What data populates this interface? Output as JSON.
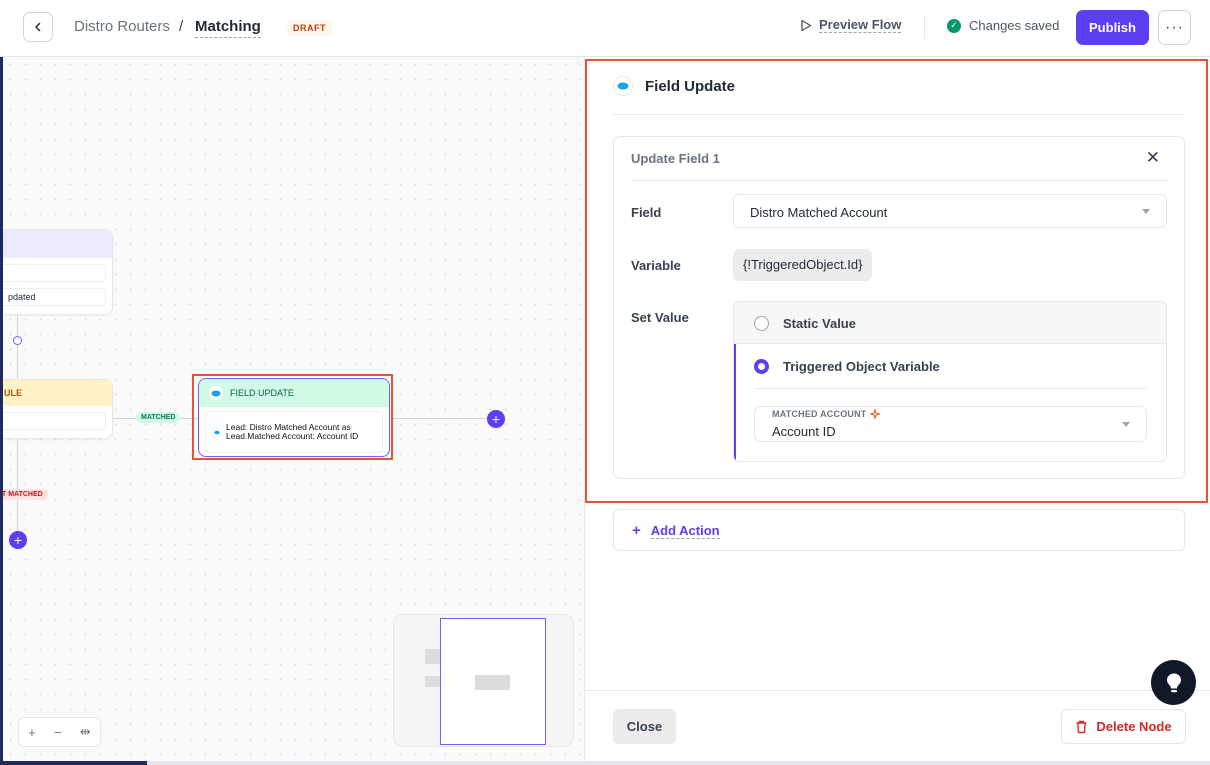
{
  "header": {
    "breadcrumb_parent": "Distro Routers",
    "breadcrumb_separator": "/",
    "breadcrumb_current": "Matching",
    "status_badge": "DRAFT",
    "preview_label": "Preview Flow",
    "saved_label": "Changes saved",
    "publish_label": "Publish"
  },
  "canvas": {
    "node_top_text": "pdated",
    "node_rule_label": "ULE",
    "edge_matched": "MATCHED",
    "edge_not_matched": "T MATCHED",
    "field_update_node": {
      "title": "FIELD UPDATE",
      "body": "Lead: Distro Matched Account as Lead.Matched Account: Account ID"
    }
  },
  "panel": {
    "title": "Field Update",
    "card": {
      "title": "Update Field 1",
      "field_label": "Field",
      "field_value": "Distro Matched Account",
      "variable_label": "Variable",
      "variable_value": "{!TriggeredObject.Id}",
      "set_value_label": "Set Value",
      "options": [
        {
          "label": "Static Value",
          "selected": false
        },
        {
          "label": "Triggered Object Variable",
          "selected": true
        }
      ],
      "sub_select": {
        "label": "MATCHED ACCOUNT",
        "value": "Account ID"
      }
    },
    "add_action_label": "Add Action",
    "close_label": "Close",
    "delete_label": "Delete Node"
  },
  "colors": {
    "accent": "#5b3ff0",
    "highlight": "#e2553a",
    "danger": "#dc2626",
    "success": "#059669"
  }
}
